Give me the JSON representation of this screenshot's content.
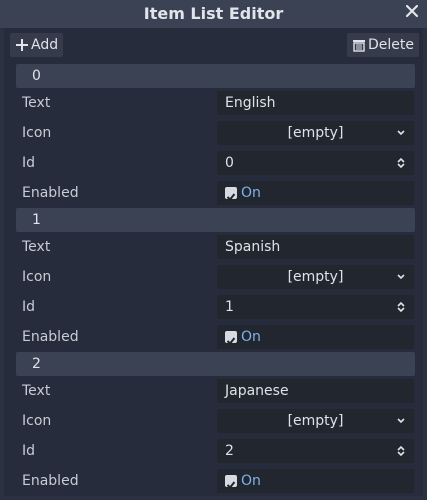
{
  "window": {
    "title": "Item List Editor"
  },
  "toolbar": {
    "add_label": "Add",
    "delete_label": "Delete"
  },
  "items": [
    {
      "index": "0",
      "text_label": "Text",
      "text_value": "English",
      "icon_label": "Icon",
      "icon_value": "[empty]",
      "id_label": "Id",
      "id_value": "0",
      "enabled_label": "Enabled",
      "enabled_value": "On"
    },
    {
      "index": "1",
      "text_label": "Text",
      "text_value": "Spanish",
      "icon_label": "Icon",
      "icon_value": "[empty]",
      "id_label": "Id",
      "id_value": "1",
      "enabled_label": "Enabled",
      "enabled_value": "On"
    },
    {
      "index": "2",
      "text_label": "Text",
      "text_value": "Japanese",
      "icon_label": "Icon",
      "icon_value": "[empty]",
      "id_label": "Id",
      "id_value": "2",
      "enabled_label": "Enabled",
      "enabled_value": "On"
    }
  ],
  "colors": {
    "background": "#262c3b",
    "header": "#3b4254",
    "field": "#21262f",
    "accent": "#7fb1ea"
  }
}
